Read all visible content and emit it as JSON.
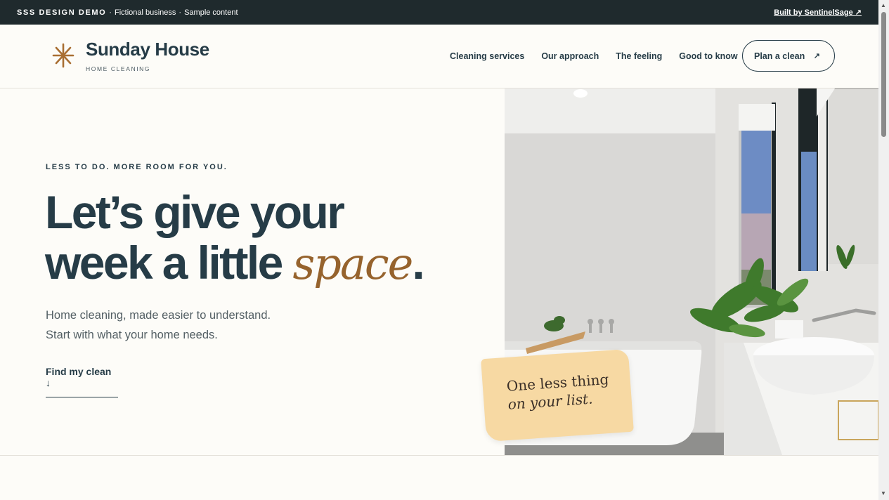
{
  "demo_bar": {
    "label": "SSS DESIGN DEMO",
    "separator": "·",
    "text1": "Fictional business",
    "text2": "Sample content",
    "built_by": "Built by SentinelSage ↗"
  },
  "brand": {
    "name": "Sunday House",
    "tagline": "HOME CLEANING",
    "icon": "asterisk-icon",
    "accent_color": "#a96f33"
  },
  "nav": {
    "items": [
      {
        "label": "Cleaning services"
      },
      {
        "label": "Our approach"
      },
      {
        "label": "The feeling"
      },
      {
        "label": "Good to know"
      }
    ],
    "cta": {
      "label": "Plan a clean",
      "arrow": "↗"
    }
  },
  "hero": {
    "eyebrow": "LESS TO DO. MORE ROOM FOR YOU.",
    "headline_line1": "Let’s give your",
    "headline_line2": "week a little ",
    "headline_accent": "space",
    "headline_period": ".",
    "subline1": "Home cleaning, made easier to understand.",
    "subline2": "Start with what your home needs.",
    "link": "Find my clean ↓"
  },
  "note": {
    "line1": "One less thing",
    "line2": "on your list."
  },
  "colors": {
    "navy": "#263c47",
    "accent": "#96632d",
    "note_bg": "#f7d9a3",
    "page_bg": "#fdfcf8"
  }
}
